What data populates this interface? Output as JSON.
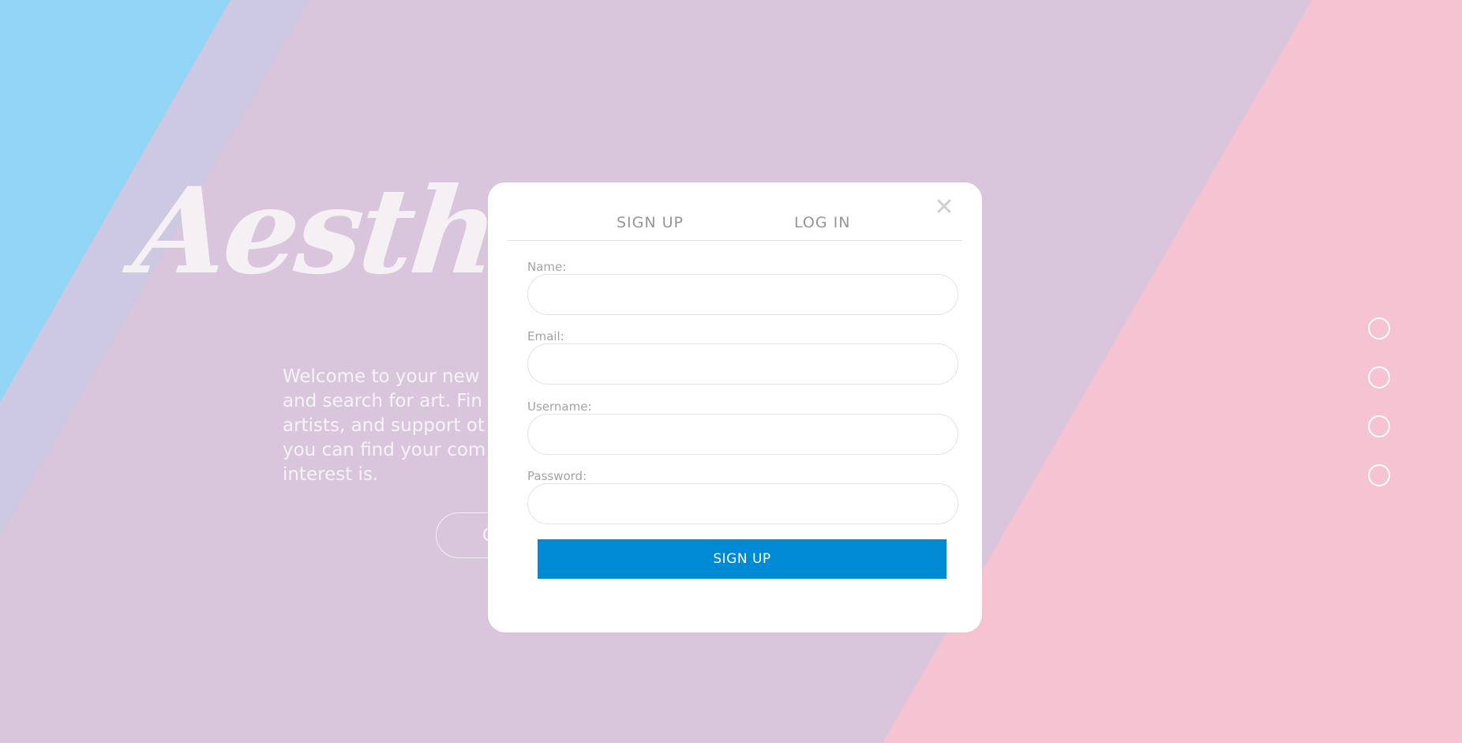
{
  "background": {
    "colors": {
      "blue": "#93d5f7",
      "lavender_light": "#cdc9e2",
      "lavender": "#d9c6dc",
      "pink": "#f5c3d2"
    }
  },
  "hero": {
    "logo_text": "Aesth",
    "welcome_lines": [
      "Welcome to your new",
      "and search for art. Fin",
      "artists, and support ot",
      "you can find your com",
      "interest is."
    ],
    "button_label": "C"
  },
  "pager": {
    "dots": [
      "slide-1",
      "slide-2",
      "slide-3",
      "slide-4"
    ]
  },
  "modal": {
    "close_icon": "close-icon",
    "close_glyph": "✕",
    "tabs": {
      "signup": "SIGN UP",
      "login": "LOG IN"
    },
    "fields": {
      "name_label": "Name:",
      "name_value": "",
      "email_label": "Email:",
      "email_value": "",
      "username_label": "Username:",
      "username_value": "",
      "password_label": "Password:",
      "password_value": ""
    },
    "submit_label": "SIGN UP",
    "accent_color": "#0089d5"
  }
}
